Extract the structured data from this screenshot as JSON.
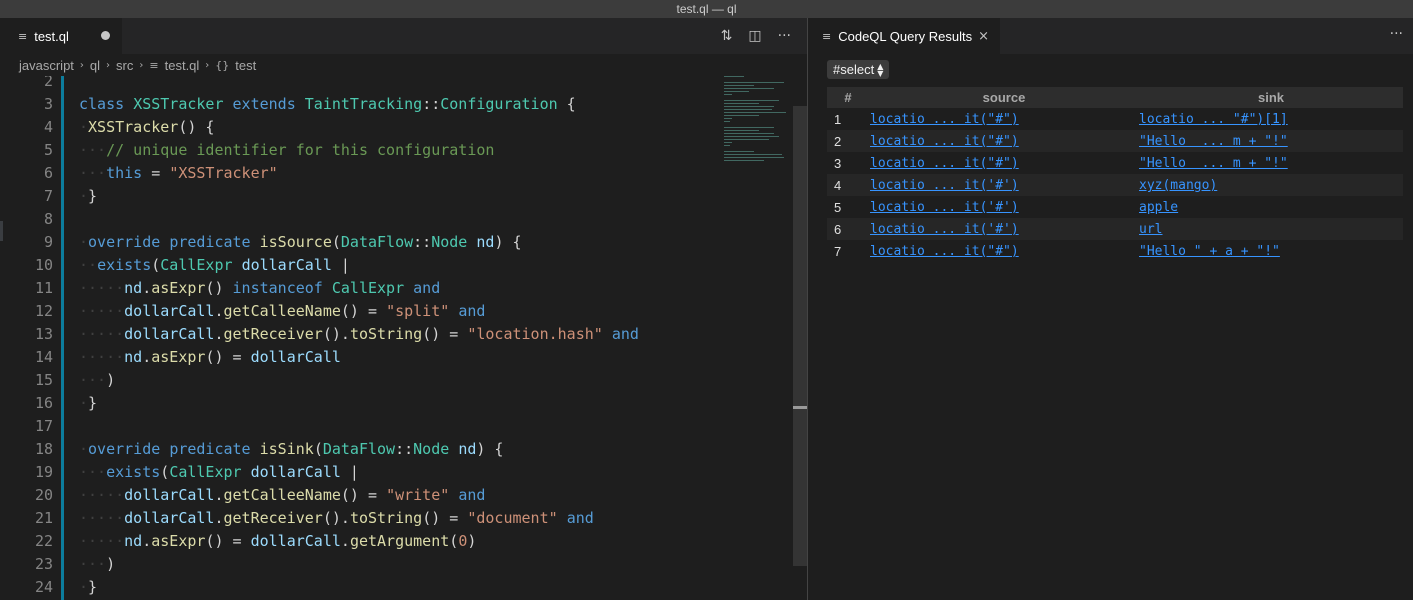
{
  "window": {
    "title": "test.ql — ql"
  },
  "editor": {
    "tab": {
      "label": "test.ql"
    },
    "breadcrumb": [
      "javascript",
      "ql",
      "src",
      "test.ql",
      "test"
    ],
    "lines": [
      {
        "n": "2",
        "html": ""
      },
      {
        "n": "3",
        "html": "<span class=\"k\">class</span> <span class=\"t\">XSSTracker</span> <span class=\"k\">extends</span> <span class=\"t\">TaintTracking</span>::<span class=\"t\">Configuration</span> {"
      },
      {
        "n": "4",
        "html": "<span class=\"ws\">·</span><span class=\"f\">XSSTracker</span>() {"
      },
      {
        "n": "5",
        "html": "<span class=\"ws\">···</span><span class=\"c\">// unique identifier for this configuration</span>"
      },
      {
        "n": "6",
        "html": "<span class=\"ws\">···</span><span class=\"k\">this</span> = <span class=\"s\">\"XSSTracker\"</span>"
      },
      {
        "n": "7",
        "html": "<span class=\"ws\">·</span>}"
      },
      {
        "n": "8",
        "html": ""
      },
      {
        "n": "9",
        "html": "<span class=\"ws\">·</span><span class=\"k\">override</span> <span class=\"k\">predicate</span> <span class=\"f\">isSource</span>(<span class=\"t\">DataFlow</span>::<span class=\"t\">Node</span> <span class=\"v\">nd</span>) {"
      },
      {
        "n": "10",
        "html": "<span class=\"ws\">··</span><span class=\"k\">exists</span>(<span class=\"t\">CallExpr</span> <span class=\"v\">dollarCall</span> |"
      },
      {
        "n": "11",
        "html": "<span class=\"ws\">·····</span><span class=\"v\">nd</span>.<span class=\"f\">asExpr</span>() <span class=\"k\">instanceof</span> <span class=\"t\">CallExpr</span> <span class=\"k\">and</span>"
      },
      {
        "n": "12",
        "html": "<span class=\"ws\">·····</span><span class=\"v\">dollarCall</span>.<span class=\"f\">getCalleeName</span>() = <span class=\"s\">\"split\"</span> <span class=\"k\">and</span>"
      },
      {
        "n": "13",
        "html": "<span class=\"ws\">·····</span><span class=\"v\">dollarCall</span>.<span class=\"f\">getReceiver</span>().<span class=\"f\">toString</span>() = <span class=\"s\">\"location.hash\"</span> <span class=\"k\">and</span>"
      },
      {
        "n": "14",
        "html": "<span class=\"ws\">·····</span><span class=\"v\">nd</span>.<span class=\"f\">asExpr</span>() = <span class=\"v\">dollarCall</span>"
      },
      {
        "n": "15",
        "html": "<span class=\"ws\">···</span>)"
      },
      {
        "n": "16",
        "html": "<span class=\"ws\">·</span>}"
      },
      {
        "n": "17",
        "html": ""
      },
      {
        "n": "18",
        "html": "<span class=\"ws\">·</span><span class=\"k\">override</span> <span class=\"k\">predicate</span> <span class=\"f\">isSink</span>(<span class=\"t\">DataFlow</span>::<span class=\"t\">Node</span> <span class=\"v\">nd</span>) {"
      },
      {
        "n": "19",
        "html": "<span class=\"ws\">···</span><span class=\"k\">exists</span>(<span class=\"t\">CallExpr</span> <span class=\"v\">dollarCall</span> |"
      },
      {
        "n": "20",
        "html": "<span class=\"ws\">·····</span><span class=\"v\">dollarCall</span>.<span class=\"f\">getCalleeName</span>() = <span class=\"s\">\"write\"</span> <span class=\"k\">and</span>"
      },
      {
        "n": "21",
        "html": "<span class=\"ws\">·····</span><span class=\"v\">dollarCall</span>.<span class=\"f\">getReceiver</span>().<span class=\"f\">toString</span>() = <span class=\"s\">\"document\"</span> <span class=\"k\">and</span>"
      },
      {
        "n": "22",
        "html": "<span class=\"ws\">·····</span><span class=\"v\">nd</span>.<span class=\"f\">asExpr</span>() = <span class=\"v\">dollarCall</span>.<span class=\"f\">getArgument</span>(<span class=\"s\">0</span>)"
      },
      {
        "n": "23",
        "html": "<span class=\"ws\">···</span>)"
      },
      {
        "n": "24",
        "html": "<span class=\"ws\">·</span>}"
      }
    ]
  },
  "results": {
    "tab": {
      "label": "CodeQL Query Results"
    },
    "select": {
      "value": "#select"
    },
    "columns": [
      "#",
      "source",
      "sink"
    ],
    "rows": [
      {
        "idx": "1",
        "source": "locatio ... it(\"#\")",
        "sink": "locatio ... \"#\")[1]"
      },
      {
        "idx": "2",
        "source": "locatio ... it(\"#\")",
        "sink": "\"Hello  ... m + \"!\""
      },
      {
        "idx": "3",
        "source": "locatio ... it(\"#\")",
        "sink": "\"Hello  ... m + \"!\""
      },
      {
        "idx": "4",
        "source": "locatio ... it('#')",
        "sink": "xyz(mango)"
      },
      {
        "idx": "5",
        "source": "locatio ... it('#')",
        "sink": "apple"
      },
      {
        "idx": "6",
        "source": "locatio ... it('#')",
        "sink": "url"
      },
      {
        "idx": "7",
        "source": "locatio ... it(\"#\")",
        "sink": "\"Hello \" + a + \"!\""
      }
    ]
  },
  "icons": {
    "file": "file-lines-icon",
    "compare": "compare-changes-icon",
    "split": "split-editor-icon",
    "more": "more-actions-icon",
    "close": "close-icon",
    "symbol": "braces-icon"
  }
}
